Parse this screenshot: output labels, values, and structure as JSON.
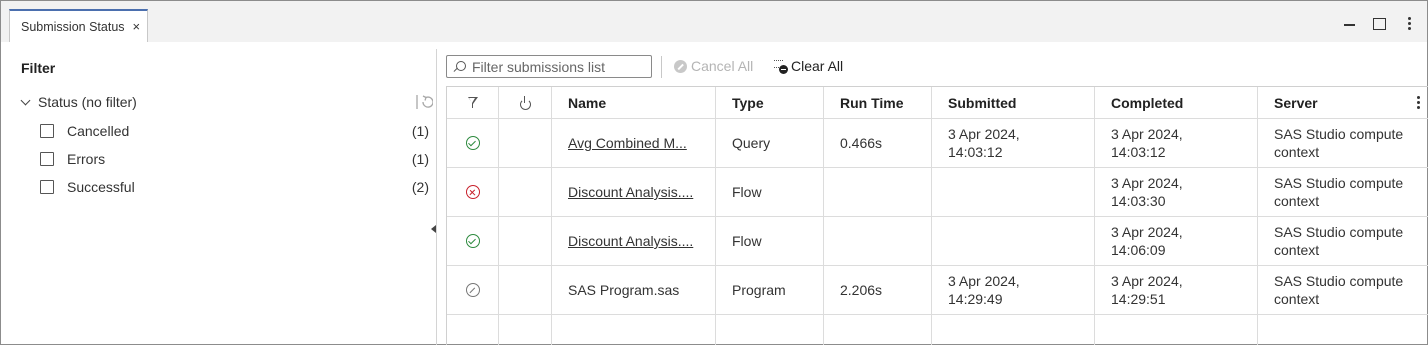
{
  "tab": {
    "label": "Submission Status",
    "close_glyph": "×"
  },
  "window_controls": [
    "minimize-icon",
    "maximize-icon",
    "kebab-menu-icon"
  ],
  "filter": {
    "title": "Filter",
    "group_label": "Status (no filter)",
    "items": [
      {
        "label": "Cancelled",
        "count": "(1)",
        "checked": false
      },
      {
        "label": "Errors",
        "count": "(1)",
        "checked": false
      },
      {
        "label": "Successful",
        "count": "(2)",
        "checked": false
      }
    ]
  },
  "toolbar": {
    "search_placeholder": "Filter submissions list",
    "cancel_all_label": "Cancel All",
    "cancel_all_enabled": false,
    "clear_all_label": "Clear All"
  },
  "table": {
    "columns": [
      "Name",
      "Type",
      "Run Time",
      "Submitted",
      "Completed",
      "Server"
    ],
    "rows": [
      {
        "status": "successful",
        "name": "Avg Combined M...",
        "type": "Query",
        "run_time": "0.466s",
        "submitted_1": "3 Apr 2024,",
        "submitted_2": "14:03:12",
        "completed_1": "3 Apr 2024,",
        "completed_2": "14:03:12",
        "server_1": "SAS Studio compute",
        "server_2": "context"
      },
      {
        "status": "error",
        "name": "Discount Analysis....",
        "type": "Flow",
        "run_time": "",
        "submitted_1": "",
        "submitted_2": "",
        "completed_1": "3 Apr 2024,",
        "completed_2": "14:03:30",
        "server_1": "SAS Studio compute",
        "server_2": "context"
      },
      {
        "status": "successful",
        "name": "Discount Analysis....",
        "type": "Flow",
        "run_time": "",
        "submitted_1": "",
        "submitted_2": "",
        "completed_1": "3 Apr 2024,",
        "completed_2": "14:06:09",
        "server_1": "SAS Studio compute",
        "server_2": "context"
      },
      {
        "status": "cancelled",
        "name": "SAS Program.sas",
        "type": "Program",
        "run_time": "2.206s",
        "submitted_1": "3 Apr 2024,",
        "submitted_2": "14:29:49",
        "completed_1": "3 Apr 2024,",
        "completed_2": "14:29:51",
        "server_1": "SAS Studio compute",
        "server_2": "context"
      }
    ]
  },
  "colors": {
    "success": "#2d8a3e",
    "error": "#c8202b",
    "cancelled": "#777777",
    "tab_accent": "#4b6fae"
  }
}
